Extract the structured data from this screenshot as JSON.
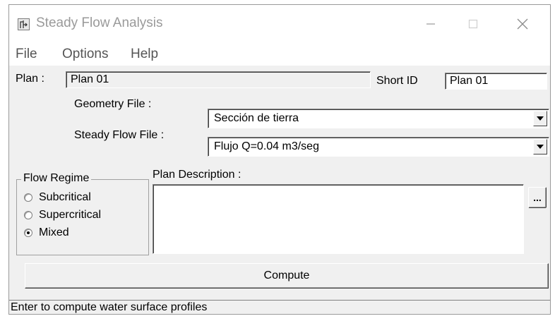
{
  "window": {
    "title": "Steady Flow Analysis",
    "controls": {
      "minimize": "minimize-icon",
      "maximize": "maximize-icon",
      "close": "close-icon"
    }
  },
  "menu": {
    "items": [
      {
        "label": "File"
      },
      {
        "label": "Options"
      },
      {
        "label": "Help"
      }
    ]
  },
  "plan": {
    "label": "Plan :",
    "value": "Plan 01",
    "short_id_label": "Short ID",
    "short_id_value": "Plan 01"
  },
  "geometry": {
    "label": "Geometry File :",
    "selected": "Sección de tierra"
  },
  "steady_flow": {
    "label": "Steady Flow File :",
    "selected": "Flujo Q=0.04 m3/seg"
  },
  "flow_regime": {
    "title": "Flow Regime",
    "options": [
      {
        "label": "Subcritical",
        "checked": false
      },
      {
        "label": "Supercritical",
        "checked": false
      },
      {
        "label": "Mixed",
        "checked": true
      }
    ]
  },
  "description": {
    "label": "Plan Description :",
    "value": "",
    "ellipsis_label": "..."
  },
  "compute_button": {
    "label": "Compute"
  },
  "status_bar": {
    "text": "Enter to compute water surface profiles"
  },
  "colors": {
    "face": "#f0f0f0",
    "titlebar": "#ffffff",
    "title_text": "#9a9a9a",
    "field": "#ffffff"
  }
}
